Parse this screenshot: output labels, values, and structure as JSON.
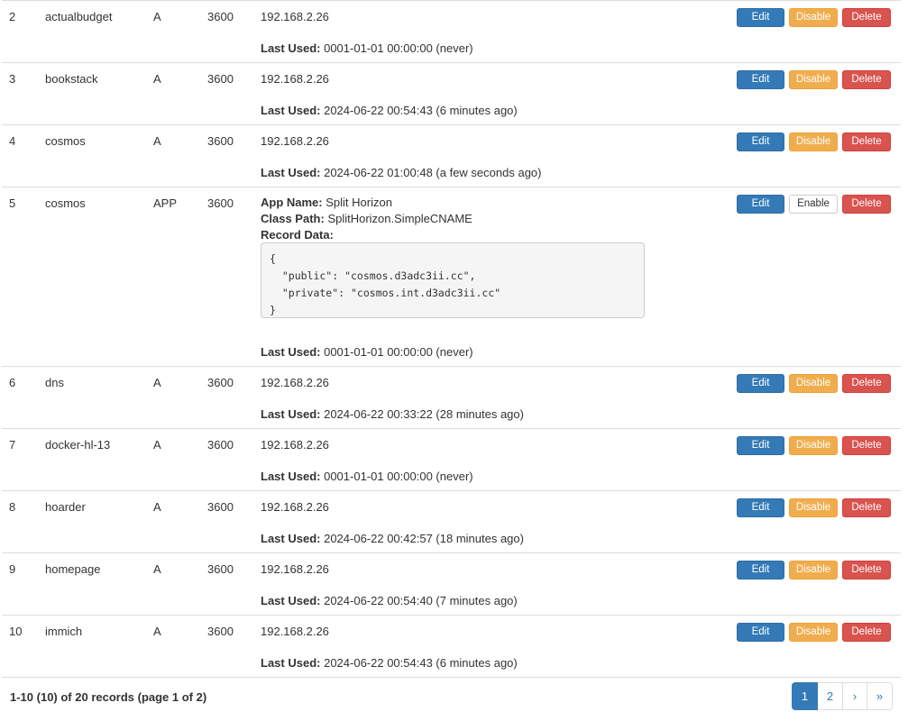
{
  "buttons": {
    "edit": "Edit",
    "disable": "Disable",
    "enable": "Enable",
    "delete": "Delete"
  },
  "labels": {
    "last_used": "Last Used:",
    "app_name": "App Name:",
    "class_path": "Class Path:",
    "record_data": "Record Data:"
  },
  "records": [
    {
      "no": "2",
      "name": "actualbudget",
      "type": "A",
      "ttl": "3600",
      "data": "192.168.2.26",
      "last_used": "0001-01-01 00:00:00 (never)"
    },
    {
      "no": "3",
      "name": "bookstack",
      "type": "A",
      "ttl": "3600",
      "data": "192.168.2.26",
      "last_used": "2024-06-22 00:54:43 (6 minutes ago)"
    },
    {
      "no": "4",
      "name": "cosmos",
      "type": "A",
      "ttl": "3600",
      "data": "192.168.2.26",
      "last_used": "2024-06-22 01:00:48 (a few seconds ago)"
    },
    {
      "no": "5",
      "name": "cosmos",
      "type": "APP",
      "ttl": "3600",
      "app_name": "Split Horizon",
      "class_path": "SplitHorizon.SimpleCNAME",
      "record_data": "{\n  \"public\": \"cosmos.d3adc3ii.cc\",\n  \"private\": \"cosmos.int.d3adc3ii.cc\"\n}",
      "last_used": "0001-01-01 00:00:00 (never)"
    },
    {
      "no": "6",
      "name": "dns",
      "type": "A",
      "ttl": "3600",
      "data": "192.168.2.26",
      "last_used": "2024-06-22 00:33:22 (28 minutes ago)"
    },
    {
      "no": "7",
      "name": "docker-hl-13",
      "type": "A",
      "ttl": "3600",
      "data": "192.168.2.26",
      "last_used": "0001-01-01 00:00:00 (never)"
    },
    {
      "no": "8",
      "name": "hoarder",
      "type": "A",
      "ttl": "3600",
      "data": "192.168.2.26",
      "last_used": "2024-06-22 00:42:57 (18 minutes ago)"
    },
    {
      "no": "9",
      "name": "homepage",
      "type": "A",
      "ttl": "3600",
      "data": "192.168.2.26",
      "last_used": "2024-06-22 00:54:40 (7 minutes ago)"
    },
    {
      "no": "10",
      "name": "immich",
      "type": "A",
      "ttl": "3600",
      "data": "192.168.2.26",
      "last_used": "2024-06-22 00:54:43 (6 minutes ago)"
    }
  ],
  "footer": {
    "summary": "1-10 (10) of 20 records (page 1 of 2)",
    "pages": [
      "1",
      "2"
    ],
    "next": "›",
    "last": "»",
    "current_page": "1"
  },
  "colors": {
    "primary": "#337ab7",
    "warning": "#f0ad4e",
    "danger": "#d9534f",
    "border": "#dddddd"
  }
}
